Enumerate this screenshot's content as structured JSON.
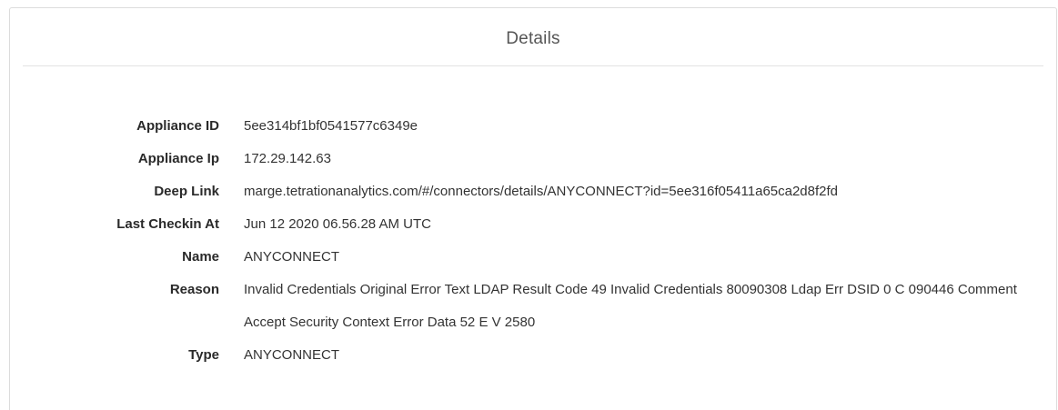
{
  "panel": {
    "title": "Details"
  },
  "details": [
    {
      "label": "Appliance ID",
      "value": "5ee314bf1bf0541577c6349e"
    },
    {
      "label": "Appliance Ip",
      "value": "172.29.142.63"
    },
    {
      "label": "Deep Link",
      "value": "marge.tetrationanalytics.com/#/connectors/details/ANYCONNECT?id=5ee316f05411a65ca2d8f2fd"
    },
    {
      "label": "Last Checkin At",
      "value": "Jun 12 2020 06.56.28 AM UTC"
    },
    {
      "label": "Name",
      "value": "ANYCONNECT"
    },
    {
      "label": "Reason",
      "value": "Invalid Credentials Original Error Text LDAP Result Code 49 Invalid Credentials 80090308 Ldap Err DSID 0 C 090446 Comment Accept Security Context Error Data 52 E V 2580"
    },
    {
      "label": "Type",
      "value": "ANYCONNECT"
    }
  ]
}
